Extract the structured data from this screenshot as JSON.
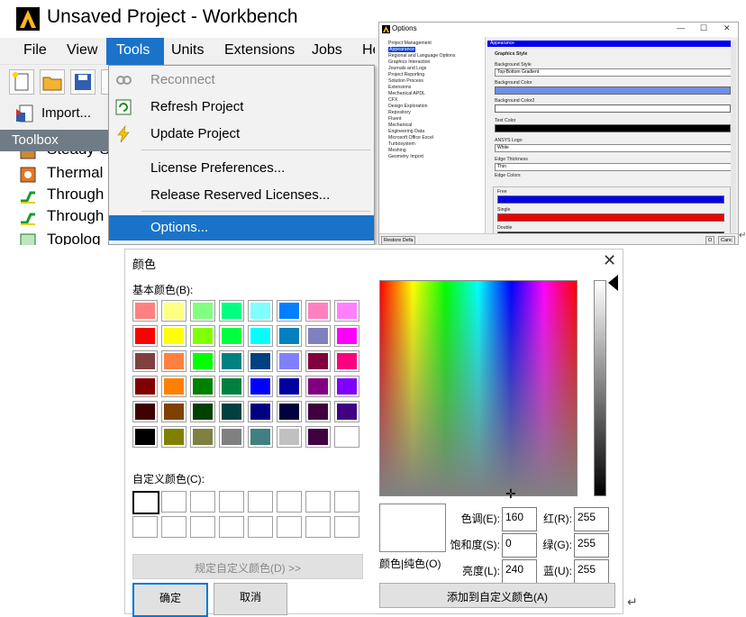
{
  "workbench": {
    "title": "Unsaved Project - Workbench",
    "menu": [
      "File",
      "View",
      "Tools",
      "Units",
      "Extensions",
      "Jobs",
      "He"
    ],
    "import_label": "Import...",
    "toolbox_title": "Toolbox",
    "toolbox_items": [
      "Steady-S",
      "Thermal",
      "Through",
      "Through",
      "Topolog"
    ]
  },
  "tools_menu": {
    "reconnect": "Reconnect",
    "refresh": "Refresh Project",
    "update": "Update Project",
    "license_prefs": "License Preferences...",
    "release_licenses": "Release Reserved Licenses...",
    "options": "Options..."
  },
  "options_dialog": {
    "title": "Options",
    "tree": [
      "Project Management",
      "Appearance",
      "Regional and Language Options",
      "Graphics Interaction",
      "Journals and Logs",
      "Project Reporting",
      "Solution Process",
      "Extensions",
      "Mechanical APDL",
      "CFX",
      "Design Exploration",
      "Repository",
      "Fluent",
      "Mechanical",
      "Engineering Data",
      "Microsoft Office Excel",
      "Turbosystem",
      "Meshing",
      "Geometry Import"
    ],
    "selected": "Appearance",
    "panel_title": "Appearance",
    "graphics_style": "Graphics Style",
    "bg_style_label": "Background Style",
    "bg_style_value": "Top-Bottom Gradient",
    "bg_color_label": "Background Color",
    "bg_color2_label": "Background Color2",
    "text_color_label": "Text Color",
    "ansys_logo_label": "ANSYS Logo",
    "ansys_logo_value": "White",
    "edge_thickness_label": "Edge Thickness",
    "edge_thickness_value": "Thin",
    "edge_colors_label": "Edge Colors",
    "free_label": "Free",
    "single_label": "Single",
    "double_label": "Double",
    "restore_label": "Restore Defa",
    "ok_label": "O",
    "cancel_label": "Canc",
    "colors": {
      "bg": "#6f8fe6",
      "bg2": "#ffffff",
      "text": "#000000",
      "free": "#0000ee",
      "single": "#ee0000",
      "double": "#222222"
    }
  },
  "color_dialog": {
    "title": "颜色",
    "close": "✕",
    "basic_label": "基本颜色(B):",
    "basic_colors": [
      "#ff8080",
      "#ffff80",
      "#80ff80",
      "#00ff80",
      "#80ffff",
      "#0080ff",
      "#ff80c0",
      "#ff80ff",
      "#ff0000",
      "#ffff00",
      "#80ff00",
      "#00ff40",
      "#00ffff",
      "#0080c0",
      "#8080c0",
      "#ff00ff",
      "#804040",
      "#ff8040",
      "#00ff00",
      "#008080",
      "#004080",
      "#8080ff",
      "#800040",
      "#ff0080",
      "#800000",
      "#ff8000",
      "#008000",
      "#008040",
      "#0000ff",
      "#0000a0",
      "#800080",
      "#8000ff",
      "#400000",
      "#804000",
      "#004000",
      "#004040",
      "#000080",
      "#000040",
      "#400040",
      "#400080",
      "#000000",
      "#808000",
      "#808040",
      "#808080",
      "#408080",
      "#c0c0c0",
      "#400040",
      "#ffffff"
    ],
    "custom_label": "自定义颜色(C):",
    "define_custom": "规定自定义颜色(D) >>",
    "ok": "确定",
    "cancel": "取消",
    "preview_label": "颜色|纯色(O)",
    "hue_label": "色调(E):",
    "hue": "160",
    "sat_label": "饱和度(S):",
    "sat": "0",
    "lum_label": "亮度(L):",
    "lum": "240",
    "red_label": "红(R):",
    "red": "255",
    "green_label": "绿(G):",
    "green": "255",
    "blue_label": "蓝(U):",
    "blue": "255",
    "add_custom": "添加到自定义颜色(A)"
  }
}
